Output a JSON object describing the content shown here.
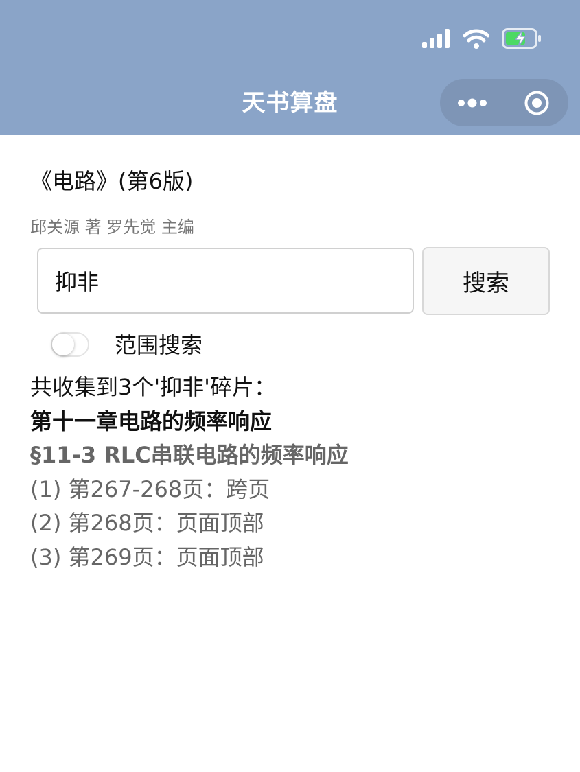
{
  "nav": {
    "title": "天书算盘",
    "more_icon": "more-dots-icon",
    "close_icon": "record-circle-icon"
  },
  "status_bar": {
    "icons": [
      "signal-icon",
      "wifi-icon",
      "battery-charging-icon"
    ]
  },
  "book": {
    "title": "《电路》(第6版)",
    "authors": "邱关源 著 罗先觉 主编"
  },
  "search": {
    "value": "抑非",
    "button_label": "搜索"
  },
  "range_toggle": {
    "label": "范围搜索",
    "enabled": false
  },
  "results": {
    "summary": "共收集到3个'抑非'碎片：",
    "chapter": "第十一章电路的频率响应",
    "section": "§11-3 RLC串联电路的频率响应",
    "entries": [
      "(1) 第267-268页：跨页",
      "(2) 第268页：页面顶部",
      "(3) 第269页：页面顶部"
    ]
  },
  "colors": {
    "header_bg": "#8aa4c8",
    "text_primary": "#111111",
    "text_secondary": "#666666",
    "battery_green": "#4cd964"
  }
}
